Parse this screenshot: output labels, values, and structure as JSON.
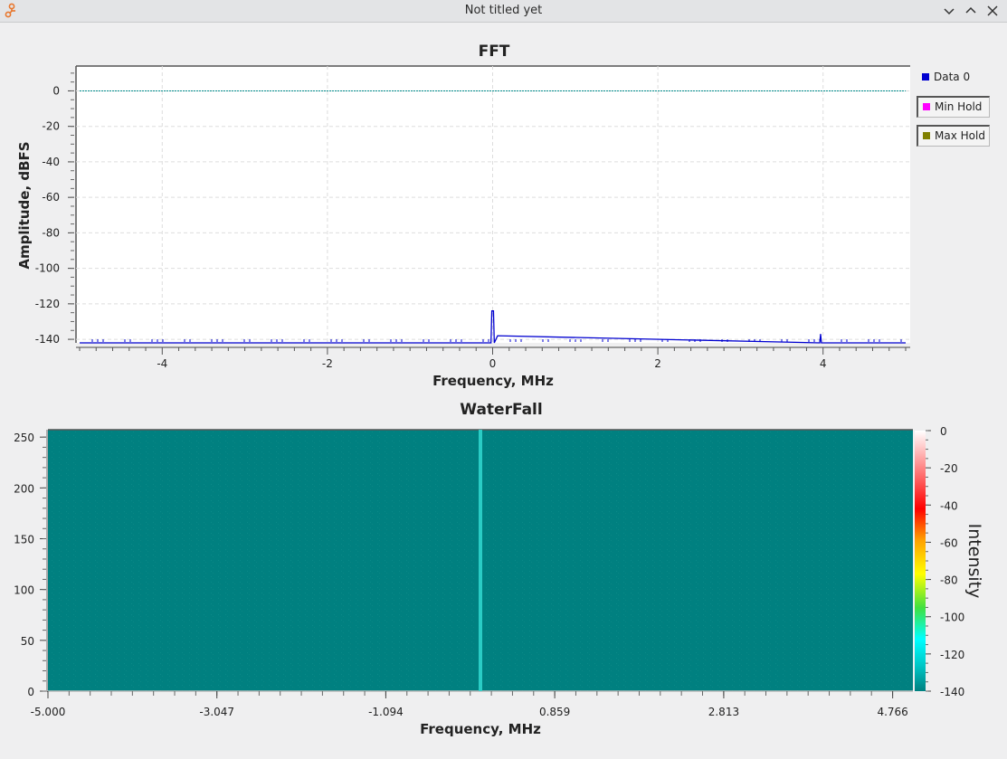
{
  "window": {
    "title": "Not titled yet",
    "controls": [
      "chevron-down-icon",
      "chevron-up-icon",
      "close-icon"
    ]
  },
  "fft": {
    "legend": [
      {
        "label": "Data 0",
        "color": "#0000d0"
      },
      {
        "label": "Min Hold",
        "color": "#ff00ff"
      },
      {
        "label": "Max Hold",
        "color": "#808000"
      }
    ],
    "chart_data": {
      "type": "line",
      "title": "FFT",
      "xlabel": "Frequency, MHz",
      "ylabel": "Amplitude, dBFS",
      "xlim": [
        -5,
        5
      ],
      "ylim": [
        -142,
        14
      ],
      "xticks": [
        "-4",
        "-2",
        "0",
        "2",
        "4"
      ],
      "xtick_values": [
        -4,
        -2,
        0,
        2,
        4
      ],
      "yticks": [
        "0",
        "-20",
        "-40",
        "-60",
        "-80",
        "-100",
        "-120",
        "-140"
      ],
      "ytick_values": [
        0,
        -20,
        -40,
        -60,
        -80,
        -100,
        -120,
        -140
      ],
      "grid": true,
      "series": [
        {
          "name": "Data 0",
          "color": "#0000d0",
          "x": [
            -5.0,
            -0.02,
            -0.01,
            0.0,
            0.01,
            0.02,
            0.06,
            3.96,
            3.97,
            3.98,
            5.0
          ],
          "y": [
            -142,
            -142,
            -124,
            -124,
            -124,
            -142,
            -138,
            -142,
            -137,
            -142,
            -142
          ]
        },
        {
          "name": "",
          "color": "#008b8b",
          "x": [
            -5.0,
            5.0
          ],
          "y": [
            0,
            0
          ]
        }
      ]
    }
  },
  "waterfall": {
    "chart_data": {
      "type": "heatmap",
      "title": "WaterFall",
      "xlabel": "Frequency, MHz",
      "ylabel": "",
      "xlim": [
        -5.0,
        5.0
      ],
      "ylim": [
        0,
        256
      ],
      "xticks": [
        "-5.000",
        "-3.047",
        "-1.094",
        "0.859",
        "2.813",
        "4.766"
      ],
      "xtick_values": [
        -5.0,
        -3.047,
        -1.094,
        0.859,
        2.813,
        4.766
      ],
      "yticks": [
        "0",
        "50",
        "100",
        "150",
        "200",
        "250"
      ],
      "ytick_values": [
        0,
        50,
        100,
        150,
        200,
        250
      ],
      "background_color": "#008080",
      "signal_line": {
        "x": 0.0,
        "color": "#2fd4cc"
      },
      "colorbar": {
        "label": "Intensity",
        "range": [
          -140,
          0
        ],
        "ticks": [
          "0",
          "-20",
          "-40",
          "-60",
          "-80",
          "-100",
          "-120",
          "-140"
        ],
        "tick_values": [
          0,
          -20,
          -40,
          -60,
          -80,
          -100,
          -120,
          -140
        ]
      }
    }
  }
}
